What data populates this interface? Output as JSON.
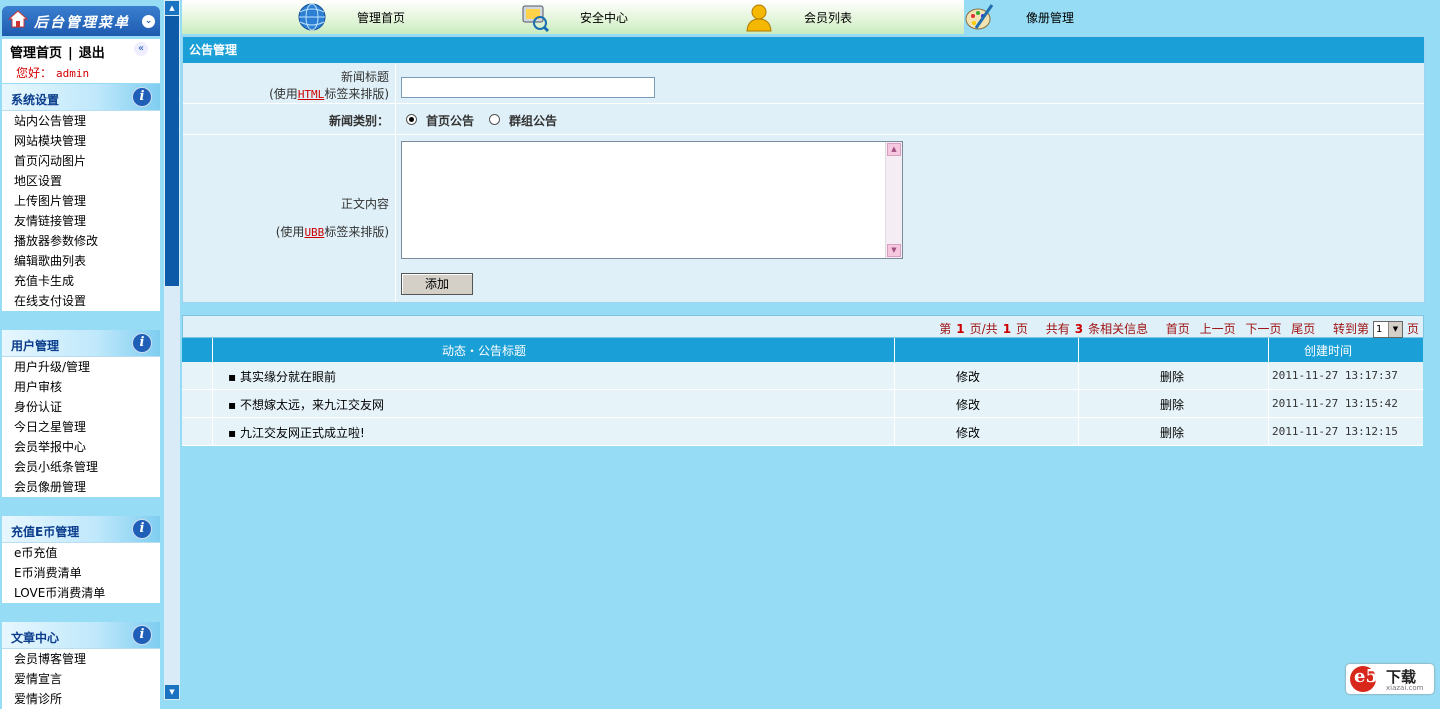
{
  "sidebar": {
    "title": "后台管理菜单",
    "admin_home": "管理首页",
    "separator": "|",
    "logout": "退出",
    "hello_label": "您好：",
    "username": "admin",
    "groups": [
      {
        "title": "系统设置",
        "items": [
          "站内公告管理",
          "网站模块管理",
          "首页闪动图片",
          "地区设置",
          "上传图片管理",
          "友情链接管理",
          "播放器参数修改",
          "编辑歌曲列表",
          "充值卡生成",
          "在线支付设置"
        ]
      },
      {
        "title": "用户管理",
        "items": [
          "用户升级/管理",
          "用户审核",
          "身份认证",
          "今日之星管理",
          "会员举报中心",
          "会员小纸条管理",
          "会员像册管理"
        ]
      },
      {
        "title": "充值E币管理",
        "items": [
          "e币充值",
          "E币消费清单",
          "LOVE币消费清单"
        ]
      },
      {
        "title": "文章中心",
        "items": [
          "会员博客管理",
          "爱情宣言",
          "爱情诊所"
        ]
      }
    ]
  },
  "topnav": {
    "tabs": [
      {
        "label": "管理首页",
        "icon": "globe-icon"
      },
      {
        "label": "安全中心",
        "icon": "security-monitor-icon"
      },
      {
        "label": "会员列表",
        "icon": "member-icon"
      },
      {
        "label": "像册管理",
        "icon": "paint-palette-icon"
      }
    ]
  },
  "form": {
    "title": "公告管理",
    "news_title_label": "新闻标题",
    "news_title_hint_prefix": "(使用",
    "news_title_hint_tag": "HTML",
    "news_title_hint_suffix": "标签来排版)",
    "news_title_value": "",
    "category_label": "新闻类别：",
    "category_options": [
      "首页公告",
      "群组公告"
    ],
    "category_selected": "首页公告",
    "content_label": "正文内容",
    "content_hint_prefix": "(使用",
    "content_hint_tag": "UBB",
    "content_hint_suffix": "标签来排版)",
    "content_value": "",
    "add_button": "添加"
  },
  "pager": {
    "page_prefix": "第",
    "current_page": "1",
    "page_mid": "页/共",
    "total_pages": "1",
    "page_suffix": "页",
    "total_prefix": "共有",
    "total_count": "3",
    "total_suffix": "条相关信息",
    "first": "首页",
    "prev": "上一页",
    "next": "下一页",
    "last": "尾页",
    "goto_label": "转到第",
    "goto_value": "1",
    "goto_suffix": "页"
  },
  "table": {
    "headers": [
      "动态・公告标题",
      "",
      "",
      "创建时间"
    ],
    "rows": [
      {
        "title": "其实缘分就在眼前",
        "edit": "修改",
        "delete": "删除",
        "created": "2011-11-27 13:17:37"
      },
      {
        "title": "不想嫁太远，来九江交友网",
        "edit": "修改",
        "delete": "删除",
        "created": "2011-11-27 13:15:42"
      },
      {
        "title": "九江交友网正式成立啦!",
        "edit": "修改",
        "delete": "删除",
        "created": "2011-11-27 13:12:15"
      }
    ]
  },
  "bullet": "▪",
  "watermark": {
    "logo": "e5",
    "text": "下载",
    "site": "xiazai.com"
  },
  "colors": {
    "header_blue": "#1a9fd6",
    "page_bg": "#96dcf4",
    "link_red": "#a01414"
  }
}
